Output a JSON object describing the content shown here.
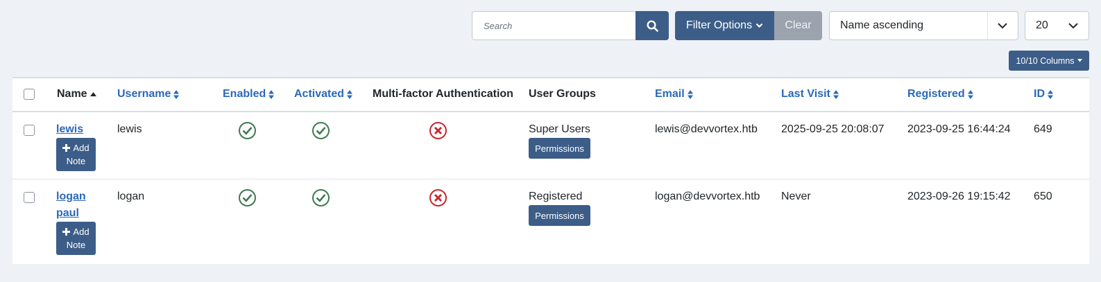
{
  "toolbar": {
    "search_placeholder": "Search",
    "filter_label": "Filter Options",
    "clear_label": "Clear",
    "sort_value": "Name ascending",
    "limit_value": "20",
    "columns_label": "10/10 Columns"
  },
  "table": {
    "headers": {
      "name": "Name",
      "username": "Username",
      "enabled": "Enabled",
      "activated": "Activated",
      "mfa": "Multi-factor Authentication",
      "groups": "User Groups",
      "email": "Email",
      "last_visit": "Last Visit",
      "registered": "Registered",
      "id": "ID"
    },
    "add_note_line1": "Add",
    "add_note_line2": "Note",
    "permissions_label": "Permissions",
    "rows": [
      {
        "name": "lewis",
        "username": "lewis",
        "enabled": "yes",
        "activated": "yes",
        "mfa": "no",
        "group": "Super Users",
        "email": "lewis@devvortex.htb",
        "last_visit": "2025-09-25 20:08:07",
        "registered": "2023-09-25 16:44:24",
        "id": "649"
      },
      {
        "name": "logan paul",
        "username": "logan",
        "enabled": "yes",
        "activated": "yes",
        "mfa": "no",
        "group": "Registered",
        "email": "logan@devvortex.htb",
        "last_visit": "Never",
        "registered": "2023-09-26 19:15:42",
        "id": "650"
      }
    ]
  },
  "colors": {
    "primary": "#3c5d88",
    "link": "#2a69b8",
    "success": "#3d7a4f",
    "danger": "#c5262f",
    "clear": "#9aa3ae"
  }
}
